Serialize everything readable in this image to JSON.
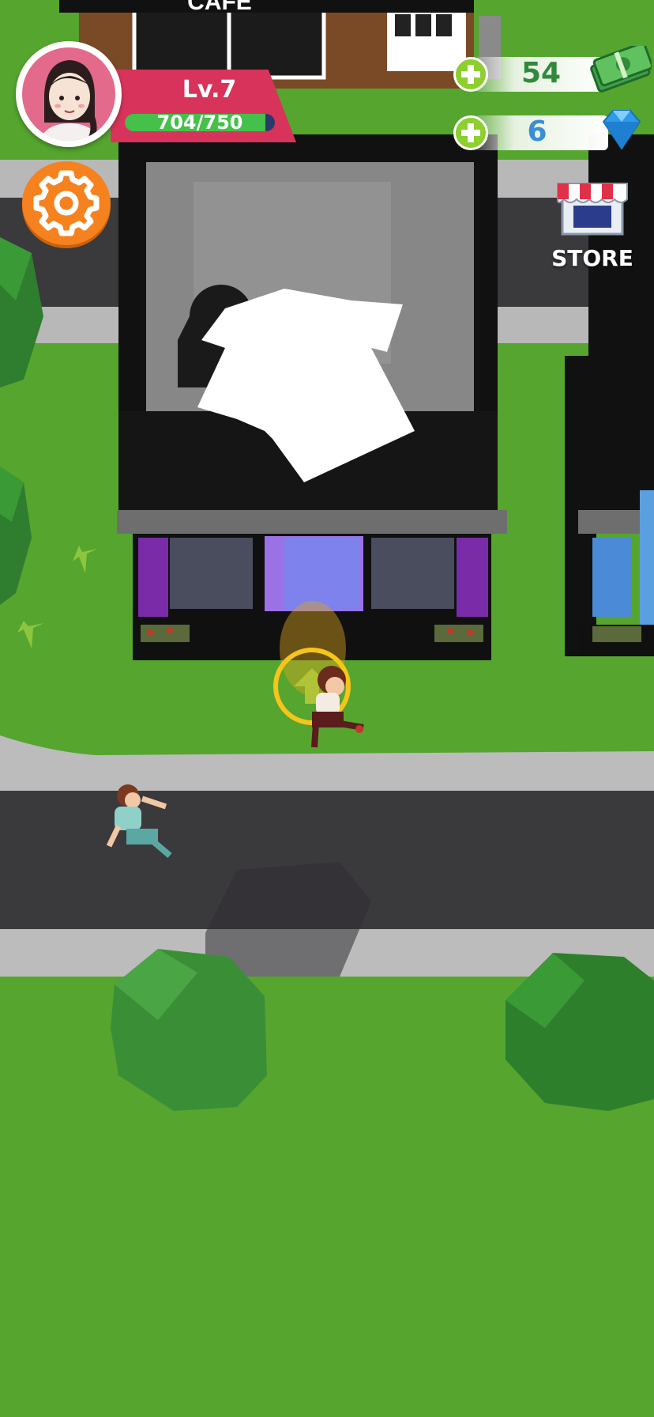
{
  "scene": {
    "cafe_sign": "CAFE",
    "colors": {
      "grass": "#55a52f",
      "road": "#3a393c",
      "sidewalk": "#bcbcbc",
      "building_roof": "#111111",
      "door": "#8d6bdc"
    }
  },
  "player": {
    "level_label": "Lv.7",
    "xp_current": 704,
    "xp_max": 750,
    "xp_text": "704/750",
    "xp_fraction": 0.939
  },
  "currency": {
    "cash": {
      "value": "54",
      "icon": "cash-icon",
      "add_icon": "plus-icon"
    },
    "gems": {
      "value": "6",
      "icon": "gem-icon",
      "add_icon": "plus-icon"
    }
  },
  "buttons": {
    "settings_icon": "gear-icon",
    "store_label": "STORE",
    "store_icon": "store-icon"
  },
  "colors": {
    "level_banner": "#d8345b",
    "xp_fill": "#45c04a",
    "settings_bg": "#f5821f",
    "plus_green": "#8ccf2e",
    "cash_text": "#2f8a3a",
    "gem_text": "#3b8ed6",
    "ring": "#f6c51c"
  }
}
